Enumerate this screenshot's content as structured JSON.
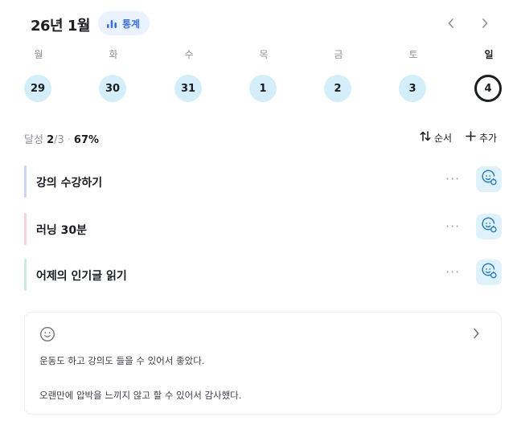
{
  "header": {
    "month_title": "26년 1월",
    "stats_label": "통계",
    "stats_icon": "bar-chart-icon",
    "prev_icon": "chevron-left-icon",
    "next_icon": "chevron-right-icon"
  },
  "week": {
    "days": [
      {
        "label": "월",
        "date": "29",
        "today": false
      },
      {
        "label": "화",
        "date": "30",
        "today": false
      },
      {
        "label": "수",
        "date": "31",
        "today": false
      },
      {
        "label": "목",
        "date": "1",
        "today": false
      },
      {
        "label": "금",
        "date": "2",
        "today": false
      },
      {
        "label": "토",
        "date": "3",
        "today": false
      },
      {
        "label": "일",
        "date": "4",
        "today": true
      }
    ]
  },
  "summary": {
    "label": "달성",
    "done": "2",
    "total": "/3",
    "separator": "·",
    "percent": "67%",
    "sort_label": "순서",
    "sort_icon": "sort-arrows-icon",
    "add_label": "추가",
    "add_icon": "plus-icon"
  },
  "habits": [
    {
      "name": "강의 수강하기",
      "color": "#c9d5f2"
    },
    {
      "name": "러닝 30분",
      "color": "#f6cfe2"
    },
    {
      "name": "어제의 인기글 읽기",
      "color": "#c9ecd9"
    }
  ],
  "diary": {
    "icon": "smiley-icon",
    "lines": [
      "운동도 하고 강의도 들을 수 있어서 좋았다.",
      "오랜만에 압박을 느끼지 않고 할 수 있어서 감사했다."
    ]
  },
  "colors": {
    "accent": "#3b6fe0",
    "day_circle": "#d4eef9",
    "mood_button": "#dff2fb",
    "mood_icon": "#2b7fb8"
  }
}
